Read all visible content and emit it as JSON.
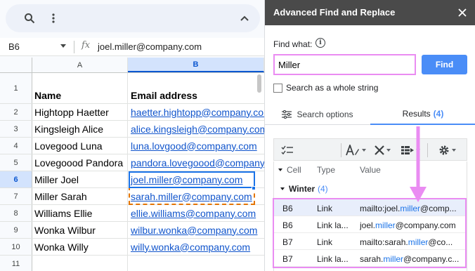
{
  "toolbar": {
    "search_icon": "search-icon",
    "menu_icon": "more-vert-icon",
    "collapse_icon": "chevron-up-icon"
  },
  "formula_bar": {
    "cell_ref": "B6",
    "fx": "fx",
    "value": "joel.miller@company.com"
  },
  "columns": {
    "a": "A",
    "b": "B"
  },
  "rows": [
    {
      "num": "1",
      "a": "Name",
      "b": "Email address"
    },
    {
      "num": "2",
      "a": "Hightopp Haetter",
      "b": "haetter.hightopp@company.com"
    },
    {
      "num": "3",
      "a": "Kingsleigh Alice",
      "b": "alice.kingsleigh@company.com"
    },
    {
      "num": "4",
      "a": "Lovegood Luna",
      "b": "luna.lovgood@company.com"
    },
    {
      "num": "5",
      "a": "Lovegoood Pandora",
      "b": "pandora.lovegoood@company.com"
    },
    {
      "num": "6",
      "a": "Miller Joel",
      "b": "joel.miller@company.com"
    },
    {
      "num": "7",
      "a": "Miller Sarah",
      "b": "sarah.miller@company.com"
    },
    {
      "num": "8",
      "a": "Williams Ellie",
      "b": "ellie.williams@company.com"
    },
    {
      "num": "9",
      "a": "Wonka Wilbur",
      "b": "wilbur.wonka@company.com"
    },
    {
      "num": "10",
      "a": "Wonka Willy",
      "b": "willy.wonka@company.com"
    },
    {
      "num": "11",
      "a": "",
      "b": ""
    }
  ],
  "sidebar": {
    "title": "Advanced Find and Replace",
    "find_label": "Find what:",
    "find_value": "Miller",
    "find_button": "Find",
    "whole_string_label": "Search as a whole string",
    "tabs": {
      "options": "Search options",
      "results": "Results",
      "results_count": "(4)"
    },
    "table": {
      "headers": {
        "cell": "Cell",
        "type": "Type",
        "value": "Value"
      },
      "group": {
        "name": "Winter",
        "count": "(4)"
      },
      "rows": [
        {
          "cell": "B6",
          "type": "Link",
          "value_pre": "mailto:joel.",
          "value_hl": "miller",
          "value_post": "@comp..."
        },
        {
          "cell": "B6",
          "type": "Link la...",
          "value_pre": "joel.",
          "value_hl": "miller",
          "value_post": "@company.com"
        },
        {
          "cell": "B7",
          "type": "Link",
          "value_pre": "mailto:sarah.",
          "value_hl": "miller",
          "value_post": "@co..."
        },
        {
          "cell": "B7",
          "type": "Link la...",
          "value_pre": "sarah.",
          "value_hl": "miller",
          "value_post": "@company.c..."
        }
      ]
    },
    "colors": {
      "accent": "#4a8df7",
      "highlight": "#ea8cf2",
      "title_bar": "#4a4a4a"
    }
  }
}
